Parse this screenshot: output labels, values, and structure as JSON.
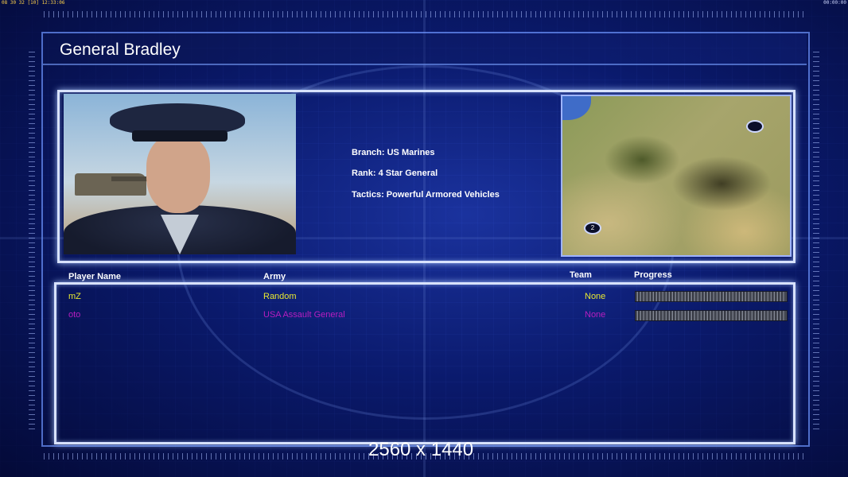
{
  "hud": {
    "left": "08 30 32 [10] 12:33:06",
    "right": "00:00:00"
  },
  "general": {
    "name": "General Bradley",
    "branch": "Branch: US Marines",
    "rank": "Rank: 4 Star General",
    "tactics": "Tactics: Powerful Armored Vehicles"
  },
  "minimap": {
    "marker_1": "",
    "marker_2": "2"
  },
  "table": {
    "headers": {
      "player": "Player Name",
      "army": "Army",
      "team": "Team",
      "progress": "Progress"
    },
    "rows": [
      {
        "player": "mZ",
        "army": "Random",
        "team": "None",
        "color": "#e8e830",
        "progress": 1.0
      },
      {
        "player": "oto",
        "army": "USA Assault General",
        "team": "None",
        "color": "#b81ec0",
        "progress": 1.0
      }
    ]
  },
  "resolution_label": "2560 x 1440",
  "colors": {
    "accent": "#d8e2ff",
    "background": "#0a1a6a"
  }
}
